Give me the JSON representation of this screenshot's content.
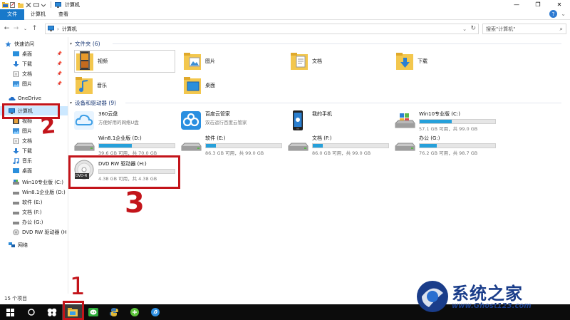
{
  "window": {
    "title": "计算机",
    "controls": {
      "minimize": "—",
      "maximize": "❐",
      "close": "✕"
    }
  },
  "ribbon": {
    "tabs": [
      "文件",
      "计算机",
      "查看"
    ],
    "help": "?",
    "expand": "⌄"
  },
  "address": {
    "crumb": "计算机",
    "sep": "›",
    "search_placeholder": "搜索\"计算机\""
  },
  "nav": {
    "quick_access": "快速访问",
    "quick_items": [
      "桌面",
      "下载",
      "文档",
      "图片"
    ],
    "onedrive": "OneDrive",
    "computer": "计算机",
    "computer_items": [
      "视频",
      "图片",
      "文档",
      "下载",
      "音乐",
      "桌面",
      "Win10专业版 (C:)",
      "Win8.1企业版 (D:)",
      "软件 (E:)",
      "文档 (F:)",
      "办公 (G:)",
      "DVD RW 驱动器 (H"
    ],
    "network": "网络"
  },
  "folders": {
    "header": "文件夹 (6)",
    "items": [
      "视频",
      "图片",
      "文档",
      "下载",
      "音乐",
      "桌面"
    ]
  },
  "devices": {
    "header": "设备和驱动器 (9)",
    "apps": [
      {
        "name": "360云盘",
        "sub": "方便好用的网络U盘"
      },
      {
        "name": "百度云管家",
        "sub": "双击运行百度云管家"
      },
      {
        "name": "我的手机",
        "sub": ""
      }
    ],
    "drives": [
      {
        "name": "Win10专业版 (C:)",
        "info": "57.1 GB 可用，共 99.0 GB",
        "used": 0.42
      },
      {
        "name": "Win8.1企业版 (D:)",
        "info": "39.6 GB 可用，共 70.0 GB",
        "used": 0.43
      },
      {
        "name": "软件 (E:)",
        "info": "86.3 GB 可用，共 99.0 GB",
        "used": 0.13
      },
      {
        "name": "文档 (F:)",
        "info": "86.0 GB 可用，共 99.0 GB",
        "used": 0.13
      },
      {
        "name": "办公 (G:)",
        "info": "76.2 GB 可用，共 98.7 GB",
        "used": 0.23
      },
      {
        "name": "DVD RW 驱动器 (H:)",
        "info": "4.38 GB 可用，共 4.38 GB",
        "used": 0.0
      }
    ],
    "dvd_badge": "DVD-R"
  },
  "status": {
    "count": "15 个项目"
  },
  "annotations": {
    "one": "1",
    "two": "2",
    "three": "3"
  },
  "watermark": {
    "title": "系统之家",
    "url": "www.Ghost123.com"
  },
  "colors": {
    "accent": "#1979ca",
    "bar": "#26a0da",
    "annotation": "#c3141a",
    "folder": "#f3c74e"
  }
}
